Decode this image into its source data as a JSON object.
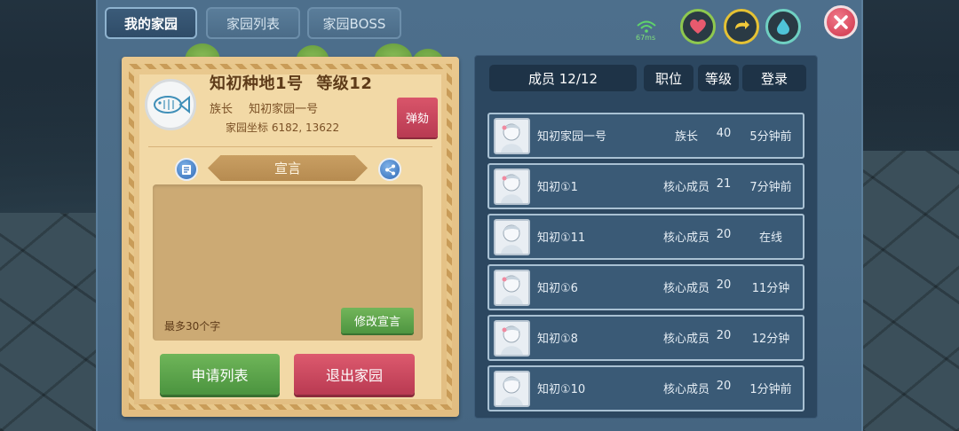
{
  "tabs": [
    "我的家园",
    "家园列表",
    "家园BOSS"
  ],
  "hud": {
    "ping": "67ms"
  },
  "home": {
    "name": "知初种地1号",
    "level": "等级12",
    "leader_label": "族长",
    "leader_name": "知初家园一号",
    "coords": "家园坐标 6182, 13622",
    "impeach": "弹劾",
    "declaration_title": "宣言",
    "max_chars": "最多30个字",
    "modify": "修改宣言",
    "apply_list": "申请列表",
    "exit": "退出家园"
  },
  "members": {
    "headers": {
      "members": "成员 12/12",
      "rank": "职位",
      "level": "等级",
      "login": "登录"
    },
    "rows": [
      {
        "name": "知初家园一号",
        "rank": "族长",
        "level": "40",
        "login": "5分钟前"
      },
      {
        "name": "知初①1",
        "rank": "核心成员",
        "level": "21",
        "login": "7分钟前"
      },
      {
        "name": "知初①11",
        "rank": "核心成员",
        "level": "20",
        "login": "在线"
      },
      {
        "name": "知初①6",
        "rank": "核心成员",
        "level": "20",
        "login": "11分钟"
      },
      {
        "name": "知初①8",
        "rank": "核心成员",
        "level": "20",
        "login": "12分钟"
      },
      {
        "name": "知初①10",
        "rank": "核心成员",
        "level": "20",
        "login": "1分钟前"
      }
    ]
  },
  "colors": {
    "accent_green": "#6fb559",
    "accent_red": "#d9556a",
    "panel_parchment": "#e9c88e",
    "window_blue": "#4d6f8c"
  }
}
